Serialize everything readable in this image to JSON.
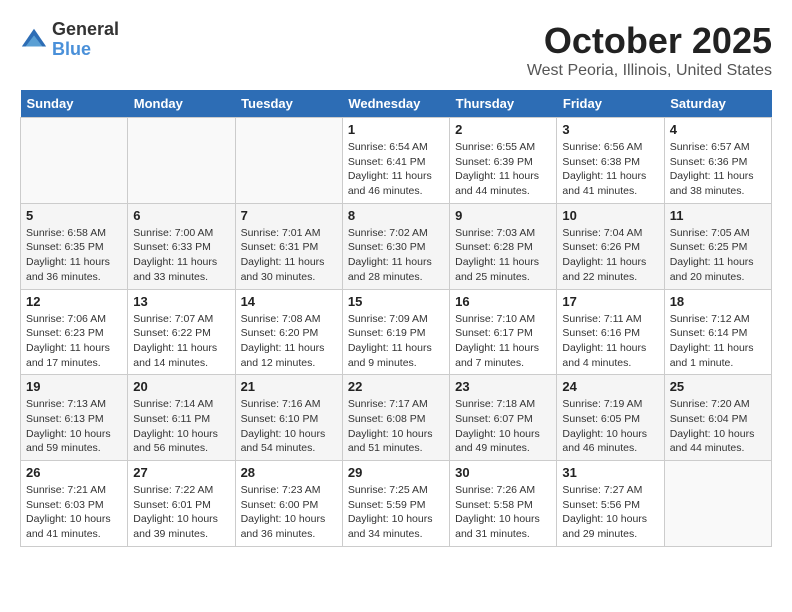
{
  "header": {
    "logo_line1": "General",
    "logo_line2": "Blue",
    "title": "October 2025",
    "subtitle": "West Peoria, Illinois, United States"
  },
  "days_of_week": [
    "Sunday",
    "Monday",
    "Tuesday",
    "Wednesday",
    "Thursday",
    "Friday",
    "Saturday"
  ],
  "weeks": [
    [
      {
        "num": "",
        "detail": ""
      },
      {
        "num": "",
        "detail": ""
      },
      {
        "num": "",
        "detail": ""
      },
      {
        "num": "1",
        "detail": "Sunrise: 6:54 AM\nSunset: 6:41 PM\nDaylight: 11 hours and 46 minutes."
      },
      {
        "num": "2",
        "detail": "Sunrise: 6:55 AM\nSunset: 6:39 PM\nDaylight: 11 hours and 44 minutes."
      },
      {
        "num": "3",
        "detail": "Sunrise: 6:56 AM\nSunset: 6:38 PM\nDaylight: 11 hours and 41 minutes."
      },
      {
        "num": "4",
        "detail": "Sunrise: 6:57 AM\nSunset: 6:36 PM\nDaylight: 11 hours and 38 minutes."
      }
    ],
    [
      {
        "num": "5",
        "detail": "Sunrise: 6:58 AM\nSunset: 6:35 PM\nDaylight: 11 hours and 36 minutes."
      },
      {
        "num": "6",
        "detail": "Sunrise: 7:00 AM\nSunset: 6:33 PM\nDaylight: 11 hours and 33 minutes."
      },
      {
        "num": "7",
        "detail": "Sunrise: 7:01 AM\nSunset: 6:31 PM\nDaylight: 11 hours and 30 minutes."
      },
      {
        "num": "8",
        "detail": "Sunrise: 7:02 AM\nSunset: 6:30 PM\nDaylight: 11 hours and 28 minutes."
      },
      {
        "num": "9",
        "detail": "Sunrise: 7:03 AM\nSunset: 6:28 PM\nDaylight: 11 hours and 25 minutes."
      },
      {
        "num": "10",
        "detail": "Sunrise: 7:04 AM\nSunset: 6:26 PM\nDaylight: 11 hours and 22 minutes."
      },
      {
        "num": "11",
        "detail": "Sunrise: 7:05 AM\nSunset: 6:25 PM\nDaylight: 11 hours and 20 minutes."
      }
    ],
    [
      {
        "num": "12",
        "detail": "Sunrise: 7:06 AM\nSunset: 6:23 PM\nDaylight: 11 hours and 17 minutes."
      },
      {
        "num": "13",
        "detail": "Sunrise: 7:07 AM\nSunset: 6:22 PM\nDaylight: 11 hours and 14 minutes."
      },
      {
        "num": "14",
        "detail": "Sunrise: 7:08 AM\nSunset: 6:20 PM\nDaylight: 11 hours and 12 minutes."
      },
      {
        "num": "15",
        "detail": "Sunrise: 7:09 AM\nSunset: 6:19 PM\nDaylight: 11 hours and 9 minutes."
      },
      {
        "num": "16",
        "detail": "Sunrise: 7:10 AM\nSunset: 6:17 PM\nDaylight: 11 hours and 7 minutes."
      },
      {
        "num": "17",
        "detail": "Sunrise: 7:11 AM\nSunset: 6:16 PM\nDaylight: 11 hours and 4 minutes."
      },
      {
        "num": "18",
        "detail": "Sunrise: 7:12 AM\nSunset: 6:14 PM\nDaylight: 11 hours and 1 minute."
      }
    ],
    [
      {
        "num": "19",
        "detail": "Sunrise: 7:13 AM\nSunset: 6:13 PM\nDaylight: 10 hours and 59 minutes."
      },
      {
        "num": "20",
        "detail": "Sunrise: 7:14 AM\nSunset: 6:11 PM\nDaylight: 10 hours and 56 minutes."
      },
      {
        "num": "21",
        "detail": "Sunrise: 7:16 AM\nSunset: 6:10 PM\nDaylight: 10 hours and 54 minutes."
      },
      {
        "num": "22",
        "detail": "Sunrise: 7:17 AM\nSunset: 6:08 PM\nDaylight: 10 hours and 51 minutes."
      },
      {
        "num": "23",
        "detail": "Sunrise: 7:18 AM\nSunset: 6:07 PM\nDaylight: 10 hours and 49 minutes."
      },
      {
        "num": "24",
        "detail": "Sunrise: 7:19 AM\nSunset: 6:05 PM\nDaylight: 10 hours and 46 minutes."
      },
      {
        "num": "25",
        "detail": "Sunrise: 7:20 AM\nSunset: 6:04 PM\nDaylight: 10 hours and 44 minutes."
      }
    ],
    [
      {
        "num": "26",
        "detail": "Sunrise: 7:21 AM\nSunset: 6:03 PM\nDaylight: 10 hours and 41 minutes."
      },
      {
        "num": "27",
        "detail": "Sunrise: 7:22 AM\nSunset: 6:01 PM\nDaylight: 10 hours and 39 minutes."
      },
      {
        "num": "28",
        "detail": "Sunrise: 7:23 AM\nSunset: 6:00 PM\nDaylight: 10 hours and 36 minutes."
      },
      {
        "num": "29",
        "detail": "Sunrise: 7:25 AM\nSunset: 5:59 PM\nDaylight: 10 hours and 34 minutes."
      },
      {
        "num": "30",
        "detail": "Sunrise: 7:26 AM\nSunset: 5:58 PM\nDaylight: 10 hours and 31 minutes."
      },
      {
        "num": "31",
        "detail": "Sunrise: 7:27 AM\nSunset: 5:56 PM\nDaylight: 10 hours and 29 minutes."
      },
      {
        "num": "",
        "detail": ""
      }
    ]
  ]
}
